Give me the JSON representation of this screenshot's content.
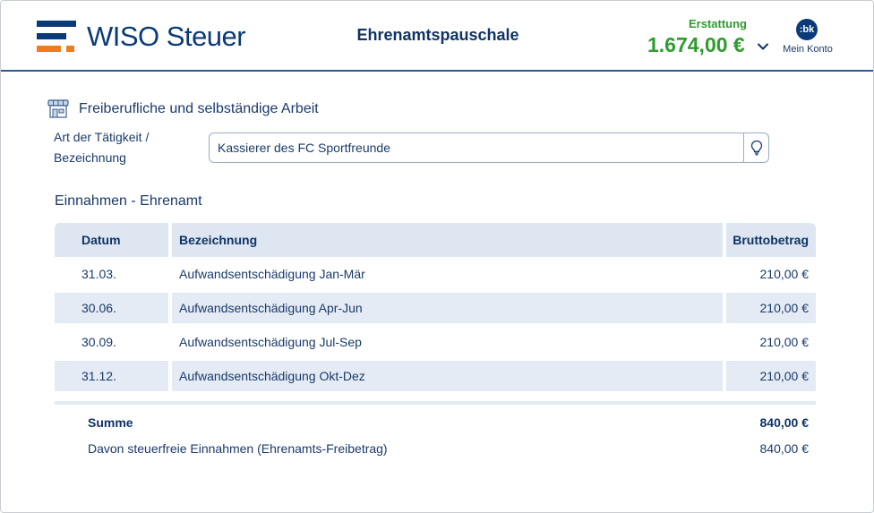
{
  "header": {
    "logo_text": "WISO Steuer",
    "page_title": "Ehrenamtspauschale",
    "refund_label": "Erstattung",
    "refund_amount": "1.674,00 €",
    "account_initials": ":bk",
    "account_label": "Mein Konto",
    "colors": {
      "brand_blue": "#0a3a78",
      "brand_orange": "#f07d19",
      "refund_green": "#2e9c2e"
    }
  },
  "section": {
    "icon": "shop-icon",
    "title": "Freiberufliche und selbständige Arbeit",
    "field_label_line1": "Art der Tätigkeit /",
    "field_label_line2": "Bezeichnung",
    "field_value": "Kassierer des FC Sportfreunde",
    "field_button_icon": "lightbulb-icon"
  },
  "income": {
    "title": "Einnahmen - Ehrenamt",
    "columns": {
      "date": "Datum",
      "desc": "Bezeichnung",
      "amount": "Bruttobetrag"
    },
    "rows": [
      {
        "date": "31.03.",
        "desc": "Aufwandsentschädigung Jan-Mär",
        "amount": "210,00 €"
      },
      {
        "date": "30.06.",
        "desc": "Aufwandsentschädigung Apr-Jun",
        "amount": "210,00 €"
      },
      {
        "date": "30.09.",
        "desc": "Aufwandsentschädigung Jul-Sep",
        "amount": "210,00 €"
      },
      {
        "date": "31.12.",
        "desc": "Aufwandsentschädigung Okt-Dez",
        "amount": "210,00 €"
      }
    ],
    "sum_label": "Summe",
    "sum_value": "840,00 €",
    "free_label": "Davon steuerfreie Einnahmen (Ehrenamts-Freibetrag)",
    "free_value": "840,00 €"
  }
}
